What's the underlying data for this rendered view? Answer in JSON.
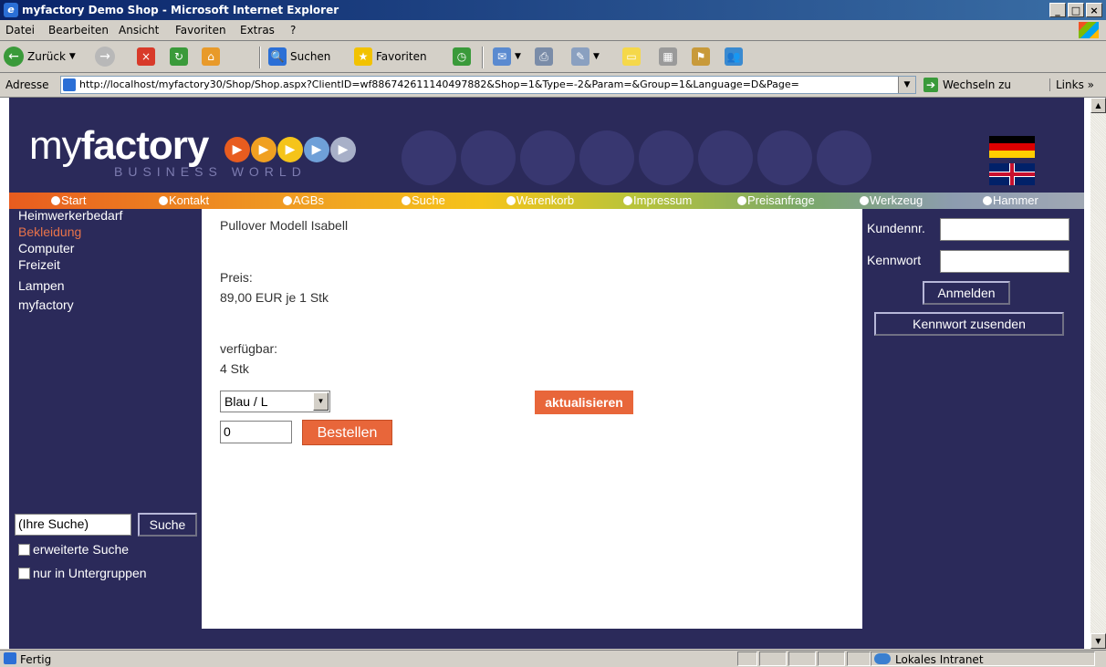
{
  "window": {
    "title": "myfactory Demo Shop - Microsoft Internet Explorer",
    "ie_glyph": "e",
    "buttons": {
      "min": "_",
      "max": "□",
      "close": "×"
    }
  },
  "menu": [
    "Datei",
    "Bearbeiten",
    "Ansicht",
    "Favoriten",
    "Extras",
    "?"
  ],
  "toolbar": {
    "back": "Zurück",
    "search": "Suchen",
    "favorites": "Favoriten",
    "glyphs": {
      "back": "←",
      "forward": "→",
      "stop": "×",
      "refresh": "↻",
      "home": "⌂",
      "search": "🔍",
      "favorites": "★",
      "history": "◷",
      "mail": "✉",
      "print": "⎙",
      "edit": "✎",
      "note": "▭",
      "messenger": "▦",
      "research": "⚑",
      "people": "👥"
    }
  },
  "address": {
    "label": "Adresse",
    "url": "http://localhost/myfactory30/Shop/Shop.aspx?ClientID=wf886742611140497882&Shop=1&Type=-2&Param=&Group=1&Language=D&Page=",
    "go_label": "Wechseln zu",
    "links_label": "Links",
    "links_chevron": "»",
    "dropdown": "▼",
    "go_glyph": "➔"
  },
  "header": {
    "logo_thin": "my",
    "logo_bold": "factory",
    "logo_sub": "BUSINESS WORLD",
    "logo_play": "▶"
  },
  "nav": [
    "Start",
    "Kontakt",
    "AGBs",
    "Suche",
    "Warenkorb",
    "Impressum",
    "Preisanfrage",
    "Werkzeug",
    "Hammer"
  ],
  "categories": [
    {
      "label": "Heimwerkerbedarf",
      "selected": false
    },
    {
      "label": "Bekleidung",
      "selected": true
    },
    {
      "label": "Computer",
      "selected": false
    },
    {
      "label": "Freizeit",
      "selected": false
    },
    {
      "label": "Lampen",
      "selected": false
    },
    {
      "label": "myfactory",
      "selected": false
    }
  ],
  "search": {
    "value": "(Ihre Suche)",
    "button": "Suche",
    "extended": "erweiterte Suche",
    "subgroups": "nur in Untergruppen"
  },
  "product": {
    "name": "Pullover Modell Isabell",
    "price_label": "Preis:",
    "price": "89,00 EUR je 1 Stk",
    "avail_label": "verfügbar:",
    "avail": "4 Stk",
    "variant": "Blau / L",
    "variant_dropdown": "▼",
    "update_button": "aktualisieren",
    "quantity": "0",
    "order_button": "Bestellen"
  },
  "login": {
    "customer_label": "Kundennr.",
    "password_label": "Kennwort",
    "login_button": "Anmelden",
    "send_button": "Kennwort zusenden"
  },
  "scroll": {
    "up": "▲",
    "down": "▼"
  },
  "status": {
    "text": "Fertig",
    "zone": "Lokales Intranet"
  },
  "colors": {
    "page_bg": "#2b2a5a",
    "accent": "#e8663a",
    "selected_category": "#e8734a"
  }
}
